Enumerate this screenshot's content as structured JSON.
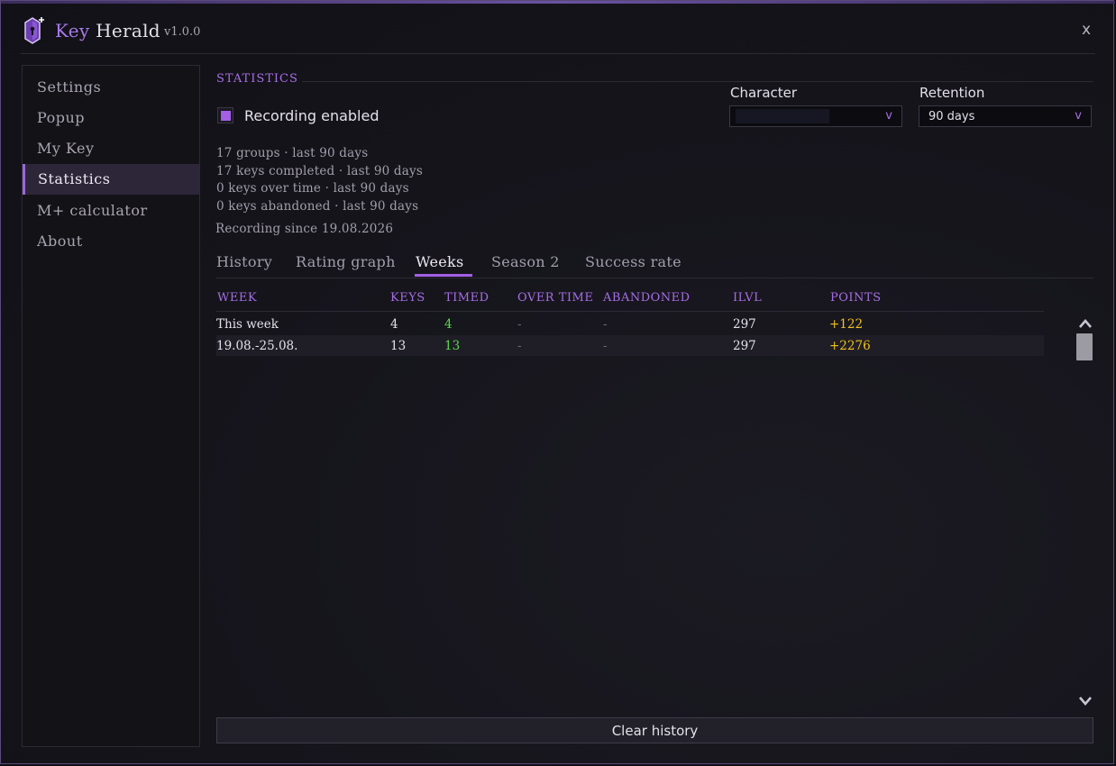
{
  "app": {
    "title_part1": "Key",
    "title_part2": "Herald",
    "version": "v1.0.0",
    "close_label": "x"
  },
  "sidebar": {
    "items": [
      {
        "label": "Settings"
      },
      {
        "label": "Popup"
      },
      {
        "label": "My Key"
      },
      {
        "label": "Statistics",
        "active": true
      },
      {
        "label": "M+ calculator"
      },
      {
        "label": "About"
      }
    ]
  },
  "statistics": {
    "section_title": "STATISTICS",
    "recording_label": "Recording enabled",
    "recording_enabled": true,
    "character": {
      "label": "Character",
      "value": "",
      "arrow": "v"
    },
    "retention": {
      "label": "Retention",
      "value": "90 days",
      "arrow": "v"
    },
    "lines": [
      "17 groups  ·  last 90 days",
      "17 keys completed  ·  last 90 days",
      "0 keys over time  ·  last 90 days",
      "0 keys abandoned  ·  last 90 days"
    ],
    "recording_since": "Recording since 19.08.2026"
  },
  "tabs": [
    {
      "label": "History"
    },
    {
      "label": "Rating graph"
    },
    {
      "label": "Weeks",
      "active": true
    },
    {
      "label": "Season 2"
    },
    {
      "label": "Success rate"
    }
  ],
  "table": {
    "headers": [
      "WEEK",
      "KEYS",
      "TIMED",
      "OVER TIME",
      "ABANDONED",
      "ILVL",
      "POINTS"
    ],
    "rows": [
      [
        "This week",
        "4",
        "4",
        "-",
        "-",
        "297",
        "+122"
      ],
      [
        "19.08.-25.08.",
        "13",
        "13",
        "-",
        "-",
        "297",
        "+2276"
      ]
    ]
  },
  "clear_button": "Clear history",
  "colors": {
    "accent": "#a35fe6",
    "timed": "#5ad84a",
    "points": "#f2c21c"
  },
  "icons": {
    "logo": "key-crystal-icon",
    "scroll_up": "chevron-up-icon",
    "scroll_down": "chevron-down-icon"
  }
}
